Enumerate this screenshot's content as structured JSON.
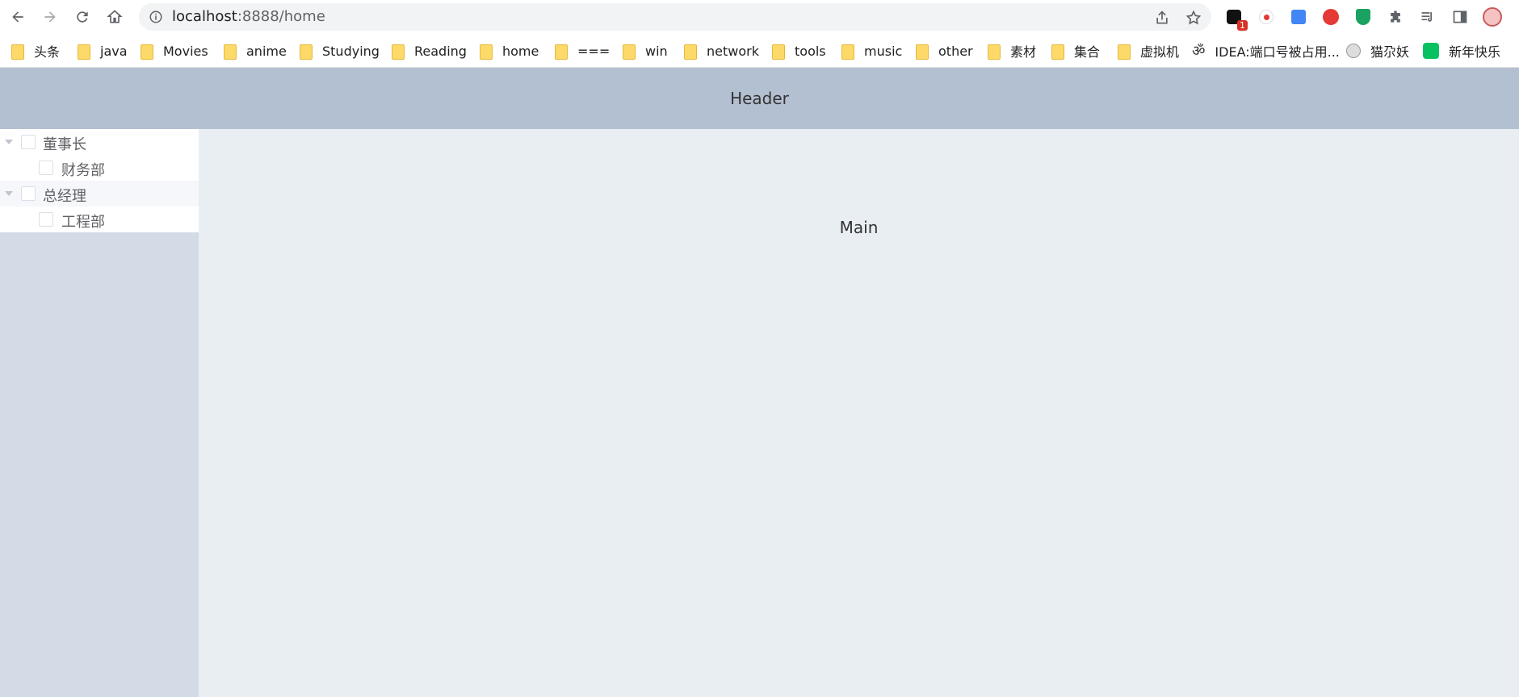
{
  "browser": {
    "url_host": "localhost",
    "url_rest": ":8888/home",
    "extension_badge": "1"
  },
  "bookmarks": [
    {
      "label": "头条",
      "icon": "folder-icon"
    },
    {
      "label": "java",
      "icon": "folder-icon"
    },
    {
      "label": "Movies",
      "icon": "folder-icon"
    },
    {
      "label": "anime",
      "icon": "folder-icon"
    },
    {
      "label": "Studying",
      "icon": "folder-icon"
    },
    {
      "label": "Reading",
      "icon": "folder-icon"
    },
    {
      "label": "home",
      "icon": "folder-icon"
    },
    {
      "label": "===",
      "icon": "folder-icon"
    },
    {
      "label": "win",
      "icon": "folder-icon"
    },
    {
      "label": "network",
      "icon": "folder-icon"
    },
    {
      "label": "tools",
      "icon": "folder-icon"
    },
    {
      "label": "music",
      "icon": "folder-icon"
    },
    {
      "label": "other",
      "icon": "folder-icon"
    },
    {
      "label": "素材",
      "icon": "folder-icon"
    },
    {
      "label": "集合",
      "icon": "folder-icon"
    },
    {
      "label": "虚拟机",
      "icon": "folder-icon"
    },
    {
      "label": "IDEA:端口号被占用...",
      "icon": "om-icon"
    },
    {
      "label": "猫尕妖",
      "icon": "cat-icon"
    },
    {
      "label": "新年快乐",
      "icon": "chat-icon"
    }
  ],
  "header": {
    "title": "Header"
  },
  "main": {
    "title": "Main"
  },
  "tree": {
    "nodes": [
      {
        "label": "董事长",
        "children": [
          {
            "label": "财务部"
          }
        ]
      },
      {
        "label": "总经理",
        "children": [
          {
            "label": "工程部"
          }
        ]
      }
    ]
  },
  "colors": {
    "header_bg": "#b3c0d1",
    "aside_bg": "#d3dce6",
    "main_bg": "#e9eef3"
  }
}
